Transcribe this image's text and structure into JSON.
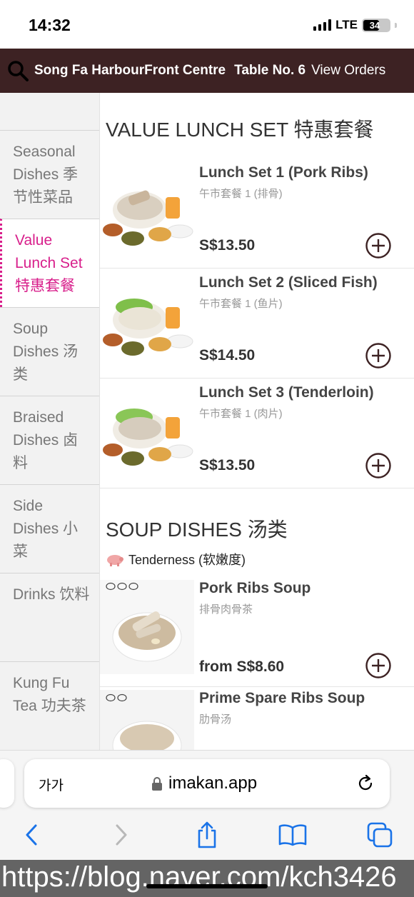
{
  "status": {
    "time": "14:32",
    "network": "LTE",
    "battery": "34"
  },
  "header": {
    "store": "Song Fa HarbourFront Centre",
    "table": "Table No. 6",
    "view_orders": "View Orders",
    "search_icon": "search-icon",
    "bg_color": "#3d2223"
  },
  "sidebar": {
    "active_color": "#d81f8b",
    "items": [
      {
        "label": "Seasonal Dishes 季节性菜品",
        "active": false
      },
      {
        "label": "Value Lunch Set 特惠套餐",
        "active": true
      },
      {
        "label": "Soup Dishes 汤类",
        "active": false
      },
      {
        "label": "Braised Dishes 卤料",
        "active": false
      },
      {
        "label": "Side Dishes 小菜",
        "active": false
      },
      {
        "label": "Drinks 饮料",
        "active": false
      },
      {
        "label": "Kung Fu Tea 功夫茶",
        "active": false
      }
    ]
  },
  "sections": [
    {
      "title": "VALUE LUNCH SET 特惠套餐",
      "items": [
        {
          "name": "Lunch Set 1 (Pork Ribs)",
          "sub": "午市套餐 1 (排骨)",
          "price": "S$13.50"
        },
        {
          "name": "Lunch Set 2 (Sliced Fish)",
          "sub": "午市套餐 1 (鱼片)",
          "price": "S$14.50"
        },
        {
          "name": "Lunch Set 3 (Tenderloin)",
          "sub": "午市套餐 1 (肉片)",
          "price": "S$13.50"
        }
      ]
    },
    {
      "title": "SOUP DISHES 汤类",
      "legend": "Tenderness (软嫩度)",
      "items": [
        {
          "name": "Pork Ribs Soup",
          "sub": "排骨肉骨茶",
          "price": "from S$8.60",
          "tenderness": "🐷🐷🐷"
        },
        {
          "name": "Prime Spare Ribs Soup",
          "sub": "肋骨汤",
          "price": "",
          "tenderness": "🐷🐷"
        }
      ]
    }
  ],
  "browser": {
    "aa": "가가",
    "domain": "imakan.app",
    "toolbar": [
      "back-icon",
      "forward-icon",
      "share-icon",
      "bookmarks-icon",
      "tabs-icon"
    ]
  },
  "watermark": "https://blog.naver.com/kch3426"
}
